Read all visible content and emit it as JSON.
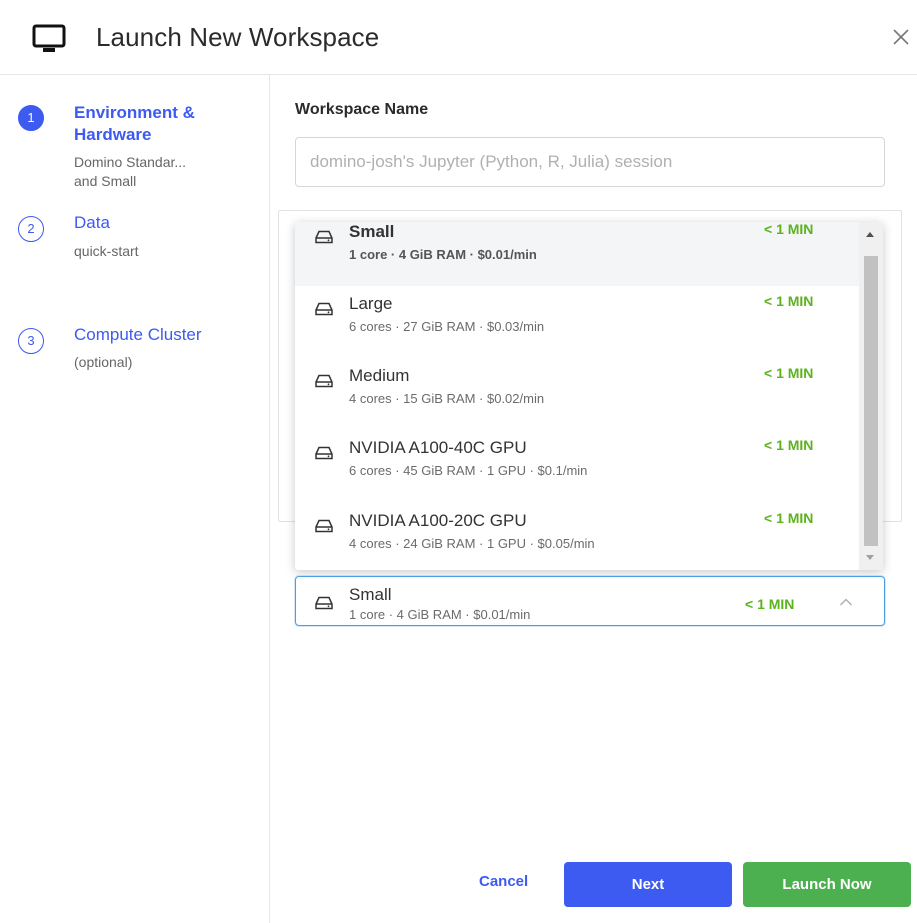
{
  "dialog": {
    "title": "Launch New Workspace"
  },
  "steps": [
    {
      "number": "1",
      "title_line1": "Environment &",
      "title_line2": "Hardware",
      "sub_line1": "Domino Standar...",
      "sub_line2": "and Small"
    },
    {
      "number": "2",
      "title": "Data",
      "sub": "quick-start"
    },
    {
      "number": "3",
      "title": "Compute Cluster",
      "sub": "(optional)"
    }
  ],
  "workspace": {
    "label": "Workspace Name",
    "placeholder": "domino-josh's Jupyter (Python, R, Julia) session",
    "value": ""
  },
  "hardware_options": [
    {
      "name": "Small",
      "spec": "1 core · 4 GiB RAM · $0.01/min",
      "time": "< 1 MIN"
    },
    {
      "name": "Large",
      "spec": "6 cores · 27 GiB RAM · $0.03/min",
      "time": "< 1 MIN"
    },
    {
      "name": "Medium",
      "spec": "4 cores · 15 GiB RAM · $0.02/min",
      "time": "< 1 MIN"
    },
    {
      "name": "NVIDIA A100-40C GPU",
      "spec": "6 cores · 45 GiB RAM · 1 GPU · $0.1/min",
      "time": "< 1 MIN"
    },
    {
      "name": "NVIDIA A100-20C GPU",
      "spec": "4 cores · 24 GiB RAM · 1 GPU · $0.05/min",
      "time": "< 1 MIN"
    }
  ],
  "selected_hardware": {
    "name": "Small",
    "spec": "1 core · 4 GiB RAM · $0.01/min",
    "time": "< 1 MIN"
  },
  "footer": {
    "cancel": "Cancel",
    "next": "Next",
    "launch": "Launch Now"
  },
  "colors": {
    "accent": "#3d5af1",
    "success": "#4caf50",
    "time_green": "#5bb31d"
  }
}
